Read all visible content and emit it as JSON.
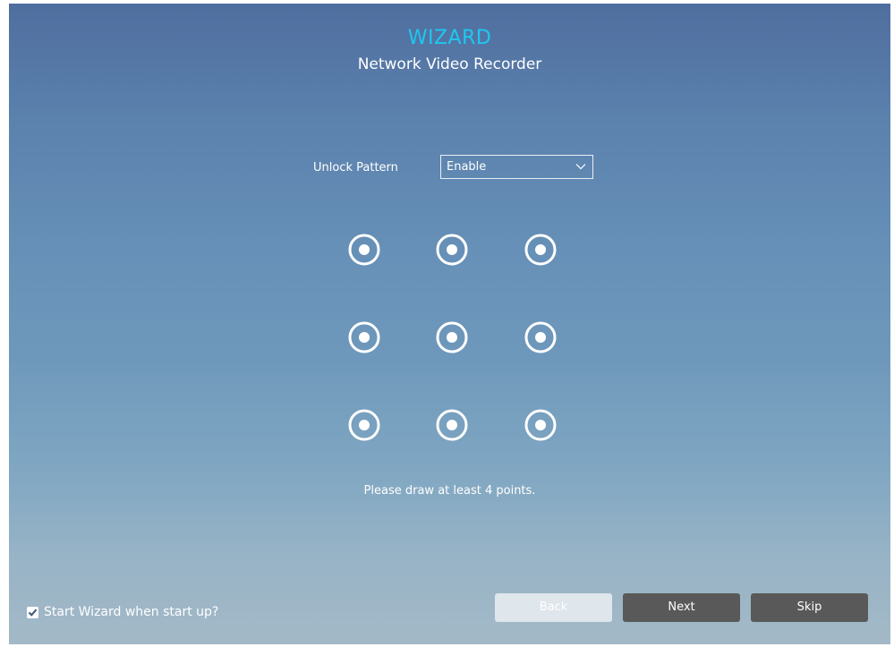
{
  "header": {
    "title": "WIZARD",
    "subtitle": "Network Video Recorder"
  },
  "unlock_pattern": {
    "label": "Unlock Pattern",
    "selected": "Enable"
  },
  "pattern_grid": {
    "rows": 3,
    "cols": 3,
    "point_color": "#ffffff"
  },
  "hint": "Please draw at least 4 points.",
  "footer": {
    "start_wizard_label": "Start Wizard when start up?",
    "start_wizard_checked": true,
    "back_label": "Back",
    "next_label": "Next",
    "skip_label": "Skip"
  },
  "colors": {
    "title": "#1ec8f0",
    "button_dark": "#595959",
    "button_disabled": "#dfe6ec"
  }
}
